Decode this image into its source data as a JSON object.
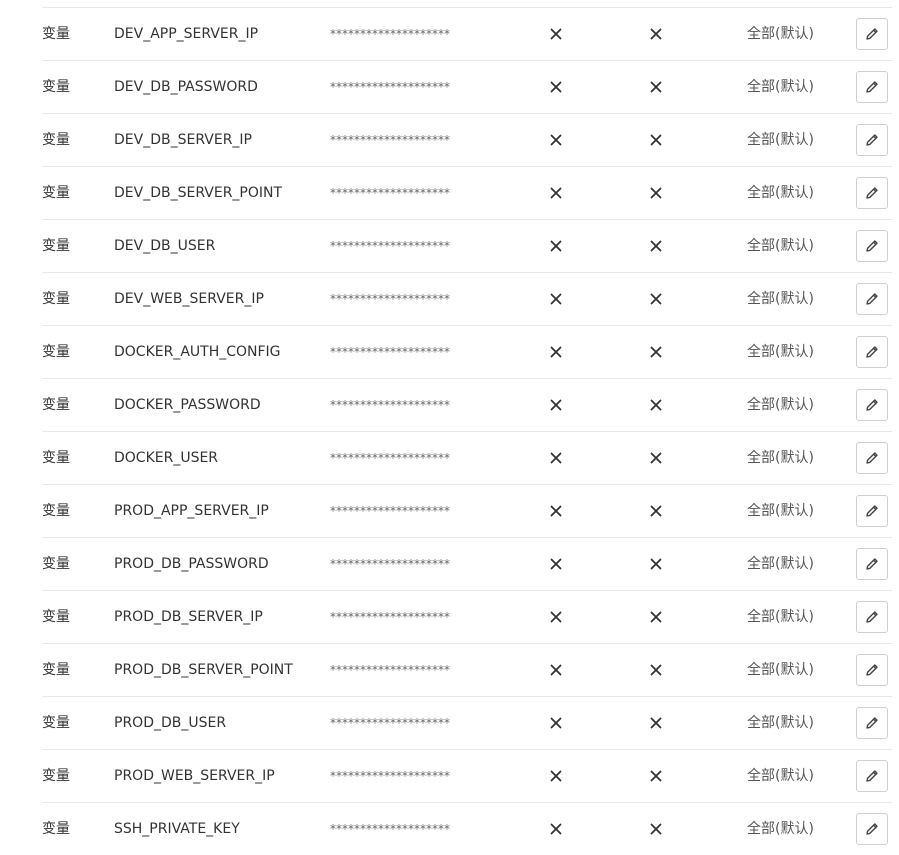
{
  "variables": {
    "rows": [
      {
        "type": "变量",
        "name": "DEV_APP_SERVER_IP",
        "value": "********************",
        "scope": "全部(默认)"
      },
      {
        "type": "变量",
        "name": "DEV_DB_PASSWORD",
        "value": "********************",
        "scope": "全部(默认)"
      },
      {
        "type": "变量",
        "name": "DEV_DB_SERVER_IP",
        "value": "********************",
        "scope": "全部(默认)"
      },
      {
        "type": "变量",
        "name": "DEV_DB_SERVER_POINT",
        "value": "********************",
        "scope": "全部(默认)"
      },
      {
        "type": "变量",
        "name": "DEV_DB_USER",
        "value": "********************",
        "scope": "全部(默认)"
      },
      {
        "type": "变量",
        "name": "DEV_WEB_SERVER_IP",
        "value": "********************",
        "scope": "全部(默认)"
      },
      {
        "type": "变量",
        "name": "DOCKER_AUTH_CONFIG",
        "value": "********************",
        "scope": "全部(默认)"
      },
      {
        "type": "变量",
        "name": "DOCKER_PASSWORD",
        "value": "********************",
        "scope": "全部(默认)"
      },
      {
        "type": "变量",
        "name": "DOCKER_USER",
        "value": "********************",
        "scope": "全部(默认)"
      },
      {
        "type": "变量",
        "name": "PROD_APP_SERVER_IP",
        "value": "********************",
        "scope": "全部(默认)"
      },
      {
        "type": "变量",
        "name": "PROD_DB_PASSWORD",
        "value": "********************",
        "scope": "全部(默认)"
      },
      {
        "type": "变量",
        "name": "PROD_DB_SERVER_IP",
        "value": "********************",
        "scope": "全部(默认)"
      },
      {
        "type": "变量",
        "name": "PROD_DB_SERVER_POINT",
        "value": "********************",
        "scope": "全部(默认)"
      },
      {
        "type": "变量",
        "name": "PROD_DB_USER",
        "value": "********************",
        "scope": "全部(默认)"
      },
      {
        "type": "变量",
        "name": "PROD_WEB_SERVER_IP",
        "value": "********************",
        "scope": "全部(默认)"
      },
      {
        "type": "变量",
        "name": "SSH_PRIVATE_KEY",
        "value": "********************",
        "scope": "全部(默认)"
      }
    ]
  },
  "icons": {
    "protected": "close-icon",
    "masked": "close-icon",
    "edit": "pencil-icon"
  },
  "colors": {
    "text": "#333333",
    "border": "#e8e8e8",
    "icon": "#333333"
  }
}
